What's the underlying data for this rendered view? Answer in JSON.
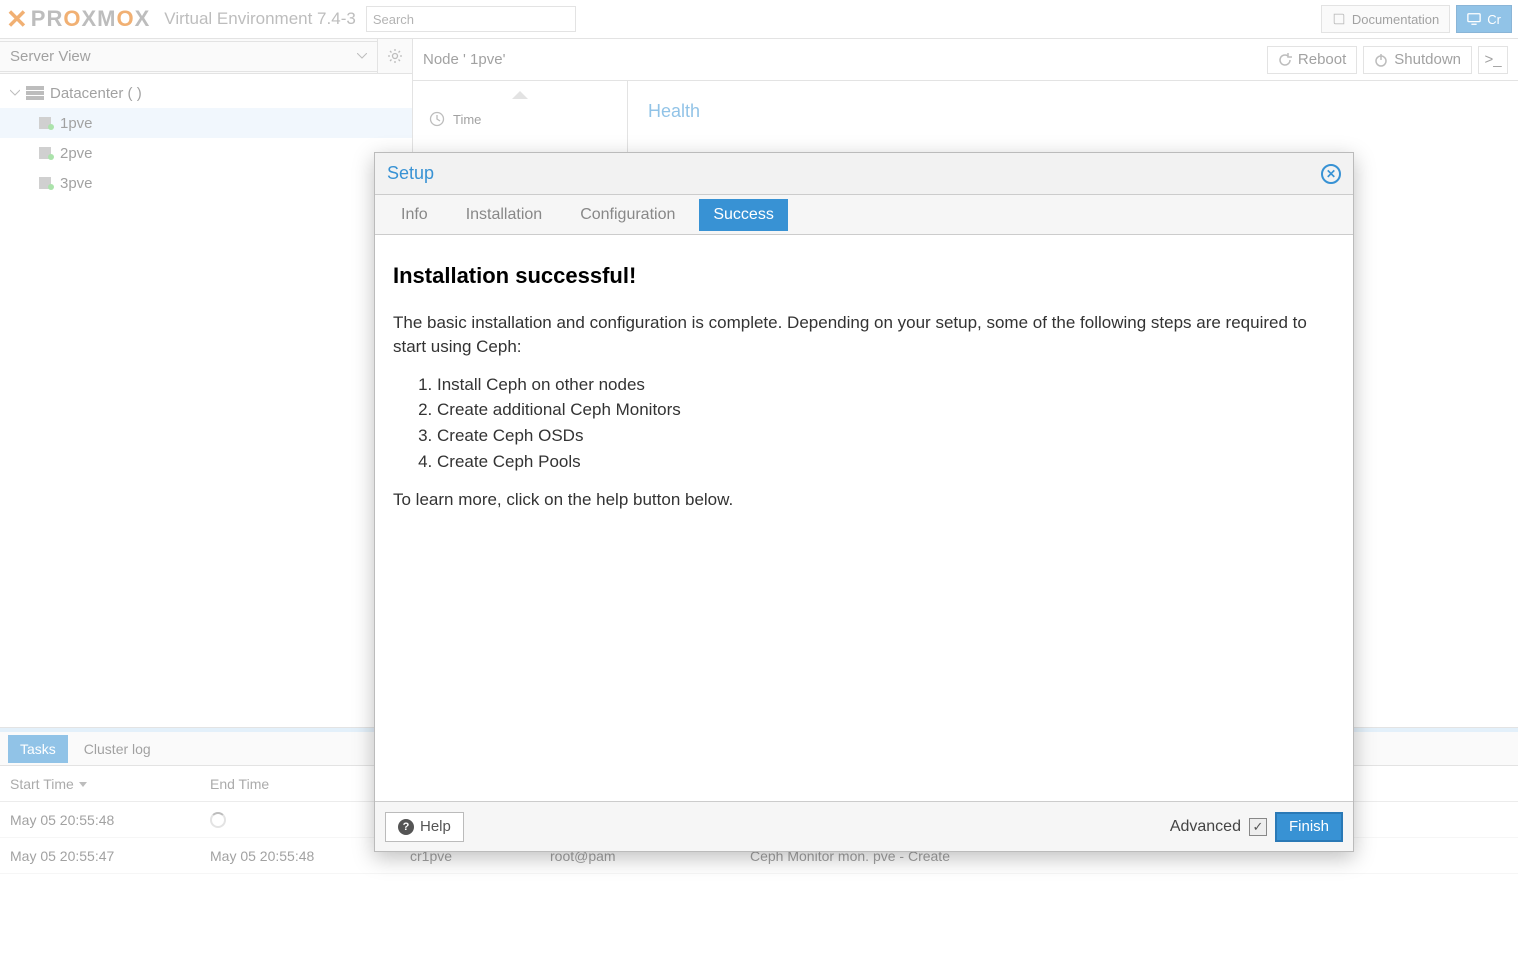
{
  "header": {
    "product": "PROXMOX",
    "subtitle": "Virtual Environment 7.4-3",
    "search_placeholder": "Search",
    "doc_btn": "Documentation",
    "create_btn": "Cr"
  },
  "sidebar": {
    "view_title": "Server View",
    "datacenter": "Datacenter (       )",
    "nodes": [
      "  1pve",
      "  2pve",
      "  3pve"
    ]
  },
  "content": {
    "node_label": "Node '   1pve'",
    "reboot": "Reboot",
    "shutdown": "Shutdown",
    "time_label": "Time",
    "health_label": "Health"
  },
  "bottom": {
    "tabs": [
      "Tasks",
      "Cluster log"
    ],
    "cols": {
      "start": "Start Time",
      "end": "End Time",
      "node": "",
      "user": "",
      "desc": ""
    },
    "rows": [
      {
        "start": "May 05 20:55:48",
        "end": "",
        "node": "",
        "user": "",
        "desc": ""
      },
      {
        "start": "May 05 20:55:47",
        "end": "May 05 20:55:48",
        "node": "cr1pve",
        "user": "root@pam",
        "desc": "Ceph Monitor mon.    pve - Create"
      }
    ]
  },
  "dialog": {
    "title": "Setup",
    "tabs": [
      "Info",
      "Installation",
      "Configuration",
      "Success"
    ],
    "heading": "Installation successful!",
    "intro": "The basic installation and configuration is complete. Depending on your setup, some of the following steps are required to start using Ceph:",
    "steps": [
      "Install Ceph on other nodes",
      "Create additional Ceph Monitors",
      "Create Ceph OSDs",
      "Create Ceph Pools"
    ],
    "outro": "To learn more, click on the help button below.",
    "help": "Help",
    "advanced": "Advanced",
    "finish": "Finish"
  }
}
